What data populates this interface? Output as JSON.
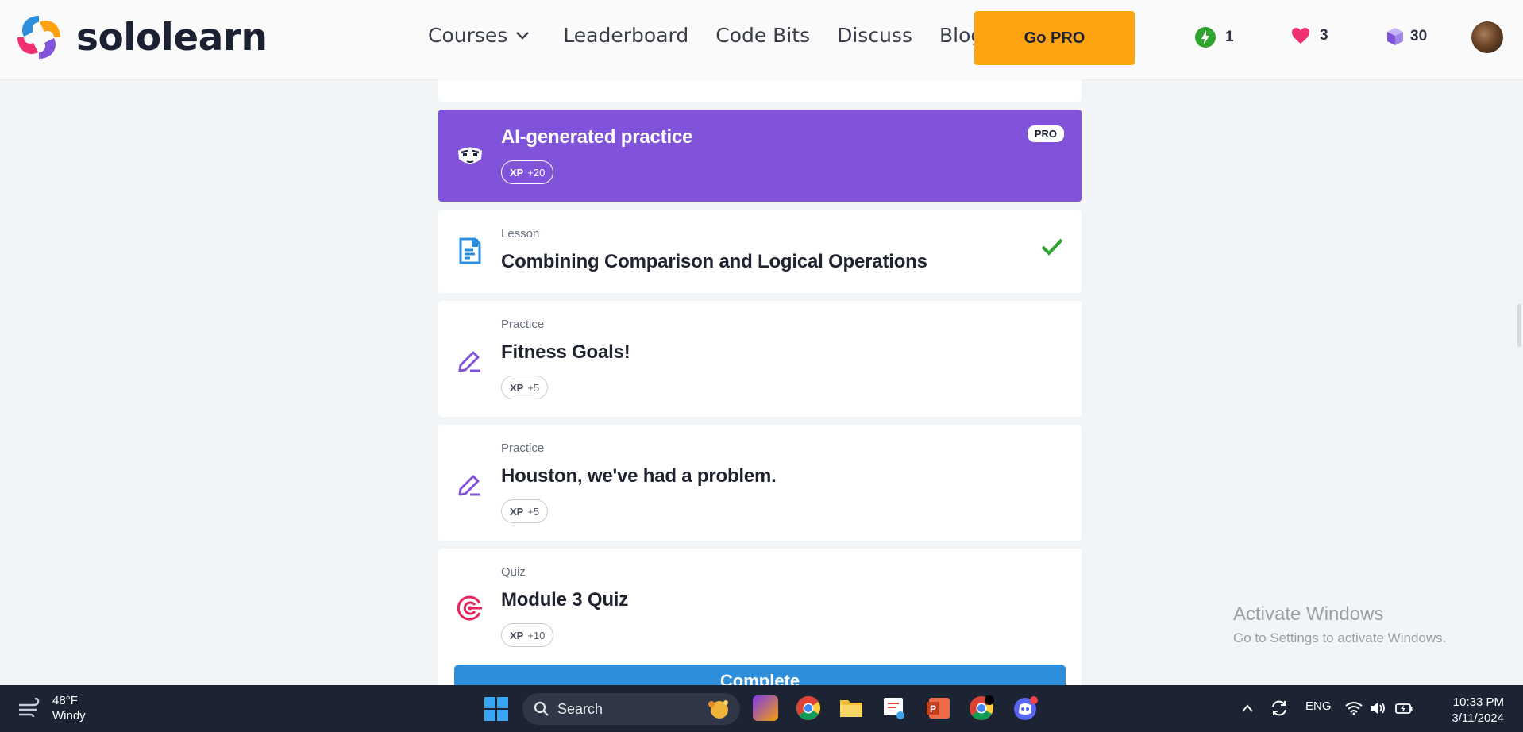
{
  "header": {
    "brand": "sololearn",
    "nav": [
      {
        "label": "Courses"
      },
      {
        "label": "Leaderboard"
      },
      {
        "label": "Code Bits"
      },
      {
        "label": "Discuss"
      },
      {
        "label": "Blog"
      }
    ],
    "go_pro_label": "Go PRO",
    "streak_count": "1",
    "hearts_count": "3",
    "gems_count": "30"
  },
  "cards": {
    "ai": {
      "title": "AI-generated practice",
      "xp_label": "XP",
      "xp_value": "+20",
      "pro_badge": "PRO"
    },
    "lesson": {
      "type": "Lesson",
      "title": "Combining Comparison and Logical Operations",
      "completed": true
    },
    "practice1": {
      "type": "Practice",
      "title": "Fitness Goals!",
      "xp_label": "XP",
      "xp_value": "+5"
    },
    "practice2": {
      "type": "Practice",
      "title": "Houston, we've had a problem.",
      "xp_label": "XP",
      "xp_value": "+5"
    },
    "quiz": {
      "type": "Quiz",
      "title": "Module 3 Quiz",
      "xp_label": "XP",
      "xp_value": "+10"
    },
    "complete_button_label": "Complete"
  },
  "watermark": {
    "line1": "Activate Windows",
    "line2": "Go to Settings to activate Windows."
  },
  "taskbar": {
    "temperature": "48°F",
    "weather": "Windy",
    "search_label": "Search",
    "language": "ENG",
    "time": "10:33 PM",
    "date": "3/11/2024"
  },
  "colors": {
    "brand_orange": "#ffa310",
    "ai_purple": "#8153db",
    "complete_blue": "#2d8fdc",
    "check_green": "#2fa32f"
  }
}
